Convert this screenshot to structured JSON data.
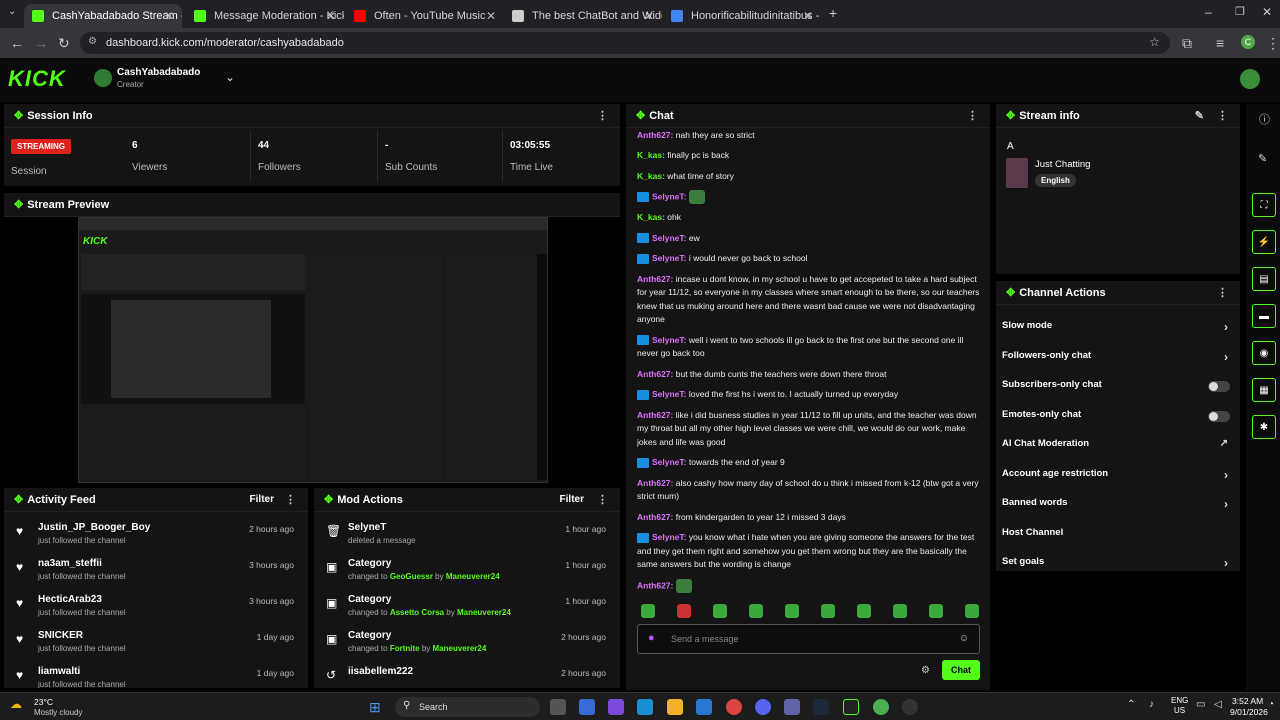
{
  "browser": {
    "tabs": [
      {
        "label": "CashYabadabado Stream - Kick",
        "color": "#53fc18",
        "active": true
      },
      {
        "label": "Message Moderation - Kick Da",
        "color": "#53fc18",
        "active": false
      },
      {
        "label": "Often - YouTube Music",
        "color": "#ff0000",
        "active": false
      },
      {
        "label": "The best ChatBot and Widgets",
        "color": "#cccccc",
        "active": false
      },
      {
        "label": "Honorificabilitudinitatibus - Go",
        "color": "#4285f4",
        "active": false
      }
    ],
    "url": "dashboard.kick.com/moderator/cashyabadabado"
  },
  "header": {
    "logo": "KICK",
    "channel_name": "CashYabadabado",
    "role": "Creator"
  },
  "session": {
    "title": "Session Info",
    "status_badge": "STREAMING",
    "session_label": "Session",
    "stats": [
      {
        "value": "6",
        "label": "Viewers"
      },
      {
        "value": "44",
        "label": "Followers"
      },
      {
        "value": "-",
        "label": "Sub Counts"
      },
      {
        "value": "03:05:55",
        "label": "Time Live"
      }
    ]
  },
  "preview": {
    "title": "Stream Preview"
  },
  "activity": {
    "title": "Activity Feed",
    "filter": "Filter",
    "items": [
      {
        "name": "Justin_JP_Booger_Boy",
        "sub": "just followed the channel",
        "time": "2 hours ago"
      },
      {
        "name": "na3am_steffii",
        "sub": "just followed the channel",
        "time": "3 hours ago"
      },
      {
        "name": "HecticArab23",
        "sub": "just followed the channel",
        "time": "3 hours ago"
      },
      {
        "name": "SNICKER",
        "sub": "just followed the channel",
        "time": "1 day ago"
      },
      {
        "name": "liamwalti",
        "sub": "just followed the channel",
        "time": "1 day ago"
      }
    ]
  },
  "modactions": {
    "title": "Mod Actions",
    "filter": "Filter",
    "items": [
      {
        "name": "SelyneT",
        "pre": "deleted a message",
        "target": "",
        "mid": "",
        "by": "",
        "time": "1 hour ago"
      },
      {
        "name": "Category",
        "pre": "changed to ",
        "target": "GeoGuessr",
        "mid": " by ",
        "by": "Maneuverer24",
        "time": "1 hour ago"
      },
      {
        "name": "Category",
        "pre": "changed to ",
        "target": "Assetto Corsa",
        "mid": " by ",
        "by": "Maneuverer24",
        "time": "1 hour ago"
      },
      {
        "name": "Category",
        "pre": "changed to ",
        "target": "Fortnite",
        "mid": " by ",
        "by": "Maneuverer24",
        "time": "2 hours ago"
      },
      {
        "name": "iisabellem222",
        "pre": "",
        "target": "",
        "mid": "",
        "by": "",
        "time": "2 hours ago"
      }
    ]
  },
  "chat": {
    "title": "Chat",
    "messages": [
      {
        "user": "Anth627",
        "cls": "u-p",
        "badge": false,
        "text": "nah they are so strict"
      },
      {
        "user": "K_kas",
        "cls": "u-g",
        "badge": false,
        "text": "finally pc is back"
      },
      {
        "user": "K_kas",
        "cls": "u-g",
        "badge": false,
        "text": "what time of story"
      },
      {
        "user": "SelyneT",
        "cls": "u-p",
        "badge": true,
        "text": ""
      },
      {
        "user": "K_kas",
        "cls": "u-g",
        "badge": false,
        "text": "ohk"
      },
      {
        "user": "SelyneT",
        "cls": "u-p",
        "badge": true,
        "text": "ew"
      },
      {
        "user": "SelyneT",
        "cls": "u-p",
        "badge": true,
        "text": "i would never go back to school"
      },
      {
        "user": "Anth627",
        "cls": "u-p",
        "badge": false,
        "text": "incase u dont know, in my school u have to get accepeted to take a hard subject for year 11/12, so everyone in my classes where smart enough to be there, so our teachers knew that us muking around here and there wasnt bad cause we were not disadvantaging anyone"
      },
      {
        "user": "SelyneT",
        "cls": "u-p",
        "badge": true,
        "text": "well i went to two schools ill go back to the first one but the second one ill never go back too"
      },
      {
        "user": "Anth627",
        "cls": "u-p",
        "badge": false,
        "text": "but the dumb cunts the teachers were down there throat"
      },
      {
        "user": "SelyneT",
        "cls": "u-p",
        "badge": true,
        "text": "loved the first hs i went to. I actually turned up everyday"
      },
      {
        "user": "Anth627",
        "cls": "u-p",
        "badge": false,
        "text": "like i did busness studies in year 11/12 to fill up units, and the teacher was down my throat but all my other high level classes we were chill, we would do our work, make jokes and life was good"
      },
      {
        "user": "SelyneT",
        "cls": "u-p",
        "badge": true,
        "text": "towards the end of year 9"
      },
      {
        "user": "Anth627",
        "cls": "u-p",
        "badge": false,
        "text": "also cashy how many day of school do u think i missed from k-12 (btw got a very strict mum)"
      },
      {
        "user": "Anth627",
        "cls": "u-p",
        "badge": false,
        "text": "from kindergarden to year 12 i missed 3 days"
      },
      {
        "user": "SelyneT",
        "cls": "u-p",
        "badge": true,
        "text": "you know what i hate when you are giving someone the answers for the test and they get them right and somehow you get them wrong but they are the basically the same answers but the wording is change"
      },
      {
        "user": "Anth627",
        "cls": "u-p",
        "badge": false,
        "text": ""
      }
    ],
    "input_placeholder": "Send a message",
    "send_label": "Chat"
  },
  "streaminfo": {
    "title": "Stream info",
    "letter": "A",
    "category": "Just Chatting",
    "language": "English"
  },
  "channel_actions": {
    "title": "Channel Actions",
    "items": [
      {
        "label": "Slow mode",
        "kind": "arrow"
      },
      {
        "label": "Followers-only chat",
        "kind": "arrow"
      },
      {
        "label": "Subscribers-only chat",
        "kind": "toggle"
      },
      {
        "label": "Emotes-only chat",
        "kind": "toggle"
      },
      {
        "label": "AI Chat Moderation",
        "kind": "external"
      },
      {
        "label": "Account age restriction",
        "kind": "arrow"
      },
      {
        "label": "Banned words",
        "kind": "arrow"
      },
      {
        "label": "Host Channel",
        "kind": "none"
      },
      {
        "label": "Set goals",
        "kind": "arrow"
      }
    ]
  },
  "taskbar": {
    "weather_temp": "23°C",
    "weather_desc": "Mostly cloudy",
    "search": "Search",
    "lang": "ENG",
    "region": "US",
    "time": "3:52 AM",
    "date": "9/01/2026"
  }
}
